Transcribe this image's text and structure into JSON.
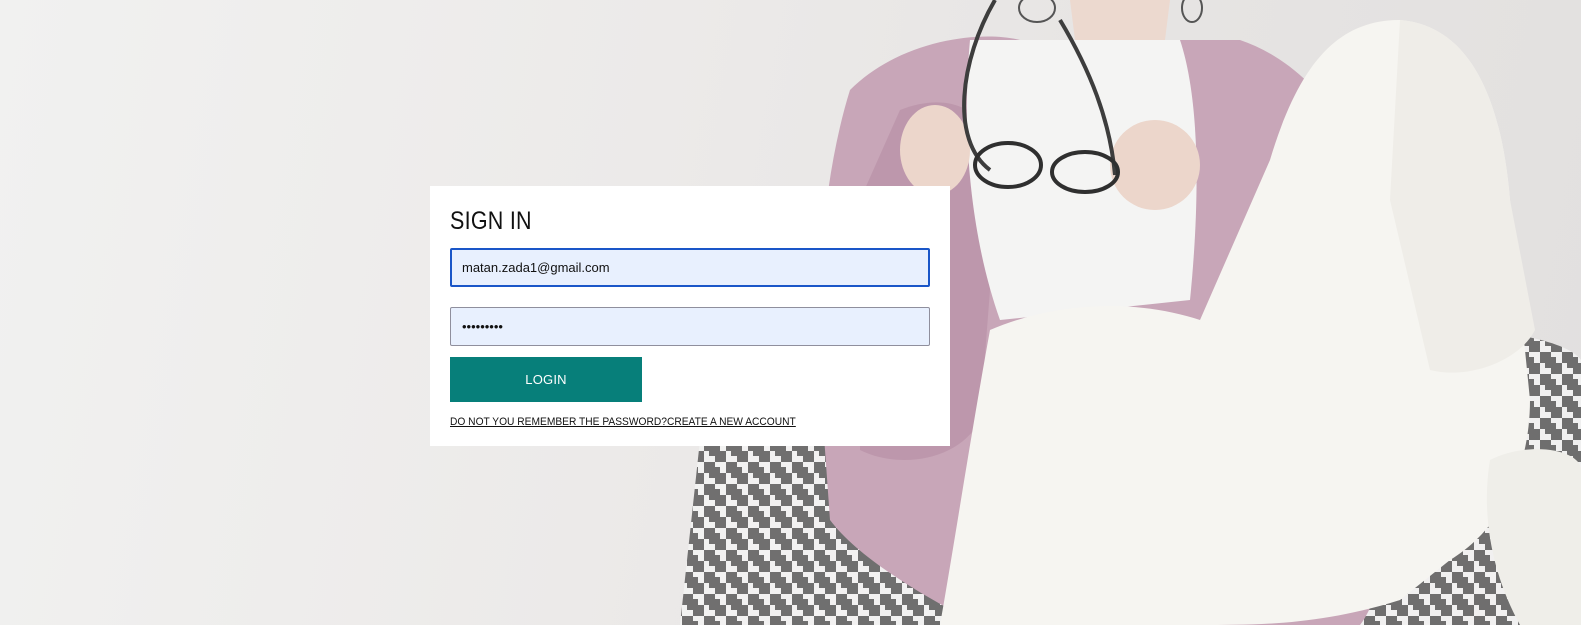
{
  "login": {
    "title": "SIGN IN",
    "email_value": "matan.zada1@gmail.com",
    "password_value": "•••••••••",
    "login_button": "LOGIN",
    "forgot_password_link": "DO NOT YOU REMEMBER THE PASSWORD?",
    "create_account_link": "CREATE A NEW ACCOUNT"
  },
  "colors": {
    "accent": "#077f7a",
    "input_background": "#e8f0fe",
    "focus_border": "#1a56c8",
    "card_background": "#ffffff"
  }
}
